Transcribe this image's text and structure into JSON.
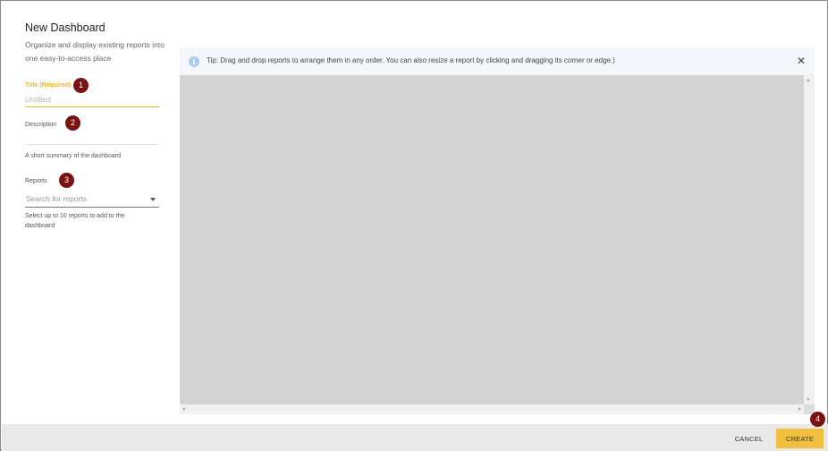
{
  "form": {
    "title": "New Dashboard",
    "subtitle": "Organize and display existing reports into one easy-to-access place",
    "title_label": "Title (Required)",
    "title_placeholder": "Untitled",
    "description_label": "Description",
    "description_hint": "A short summary of the dashboard",
    "reports_label": "Reports",
    "reports_placeholder": "Search for reports",
    "reports_hint": "Select up to 10 reports to add to the dashboard"
  },
  "tip": {
    "icon": "info-icon",
    "text": "Tip: Drag and drop reports to arrange them in any order. You can also resize a report by clicking and dragging its corner or edge.)",
    "close_glyph": "✕"
  },
  "footer": {
    "cancel_label": "CANCEL",
    "create_label": "CREATE"
  },
  "markers": {
    "m1": "1",
    "m2": "2",
    "m3": "3",
    "m4": "4"
  },
  "colors": {
    "accent": "#f3b520",
    "create_button": "#f3bf3f",
    "marker": "#7a1212",
    "canvas": "#d3d3d3",
    "tip_background": "#f3f7fc"
  }
}
